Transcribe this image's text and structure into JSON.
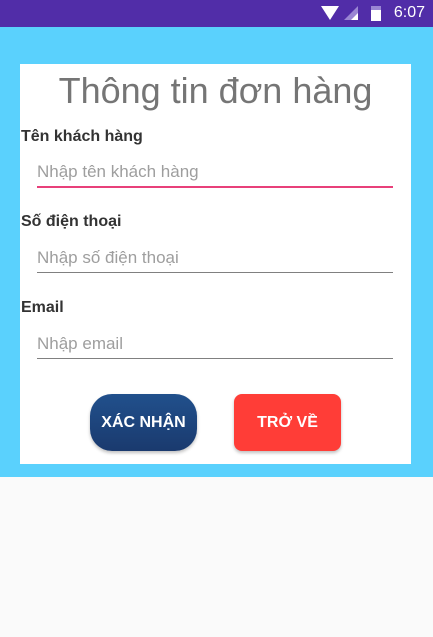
{
  "status_bar": {
    "time": "6:07",
    "icons": [
      "wifi-icon",
      "signal-icon",
      "battery-icon"
    ]
  },
  "form": {
    "title": "Thông tin đơn hàng",
    "fields": [
      {
        "label": "Tên khách hàng",
        "value": "",
        "placeholder": "Nhập tên khách hàng"
      },
      {
        "label": "Số điện thoại",
        "value": "",
        "placeholder": "Nhập số điện thoại"
      },
      {
        "label": "Email",
        "value": "",
        "placeholder": "Nhập email"
      }
    ],
    "confirm_label": "XÁC NHẬN",
    "back_label": "TRỞ VỀ"
  },
  "colors": {
    "status_bar": "#512da8",
    "background": "#5ad1fd",
    "confirm": "#1e4680",
    "back": "#ff3d37",
    "focus_underline": "#e8407a"
  }
}
